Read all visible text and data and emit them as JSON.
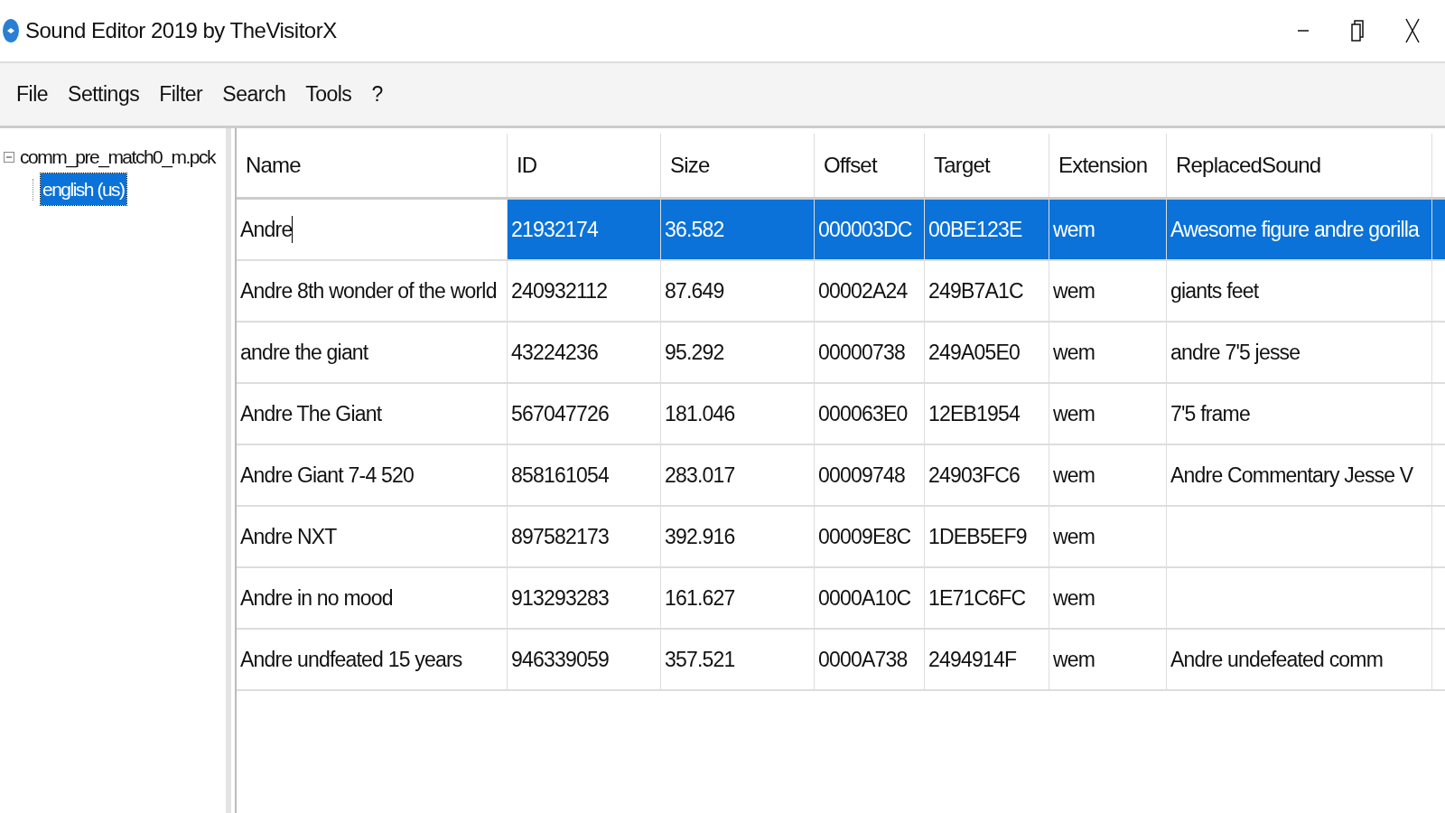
{
  "window": {
    "title": "Sound Editor 2019 by TheVisitorX"
  },
  "menu": [
    "File",
    "Settings",
    "Filter",
    "Search",
    "Tools",
    "?"
  ],
  "tree": [
    {
      "label": "comm_pre_match0_m.pck",
      "expanded": true,
      "selected": false,
      "children": [
        {
          "label": "english (us)",
          "selected": true
        }
      ]
    }
  ],
  "table": {
    "columns": [
      "Name",
      "ID",
      "Size",
      "Offset",
      "Target",
      "Extension",
      "ReplacedSound"
    ],
    "rows": [
      {
        "selected": true,
        "editing": true,
        "cells": [
          "Andre",
          "21932174",
          "36.582",
          "000003DC",
          "00BE123E",
          "wem",
          "Awesome figure andre gorilla"
        ]
      },
      {
        "selected": false,
        "editing": false,
        "cells": [
          "Andre 8th wonder of the world",
          "240932112",
          "87.649",
          "00002A24",
          "249B7A1C",
          "wem",
          "giants feet"
        ]
      },
      {
        "selected": false,
        "editing": false,
        "cells": [
          "andre the giant",
          "43224236",
          "95.292",
          "00000738",
          "249A05E0",
          "wem",
          "andre 7'5 jesse"
        ]
      },
      {
        "selected": false,
        "editing": false,
        "cells": [
          "Andre The Giant",
          "567047726",
          "181.046",
          "000063E0",
          "12EB1954",
          "wem",
          "7'5 frame"
        ]
      },
      {
        "selected": false,
        "editing": false,
        "cells": [
          "Andre Giant 7-4 520",
          "858161054",
          "283.017",
          "00009748",
          "24903FC6",
          "wem",
          "Andre Commentary Jesse V"
        ]
      },
      {
        "selected": false,
        "editing": false,
        "cells": [
          "Andre NXT",
          "897582173",
          "392.916",
          "00009E8C",
          "1DEB5EF9",
          "wem",
          ""
        ]
      },
      {
        "selected": false,
        "editing": false,
        "cells": [
          "Andre in no mood",
          "913293283",
          "161.627",
          "0000A10C",
          "1E71C6FC",
          "wem",
          ""
        ]
      },
      {
        "selected": false,
        "editing": false,
        "cells": [
          "Andre undfeated 15 years",
          "946339059",
          "357.521",
          "0000A738",
          "2494914F",
          "wem",
          "Andre undefeated comm"
        ]
      }
    ]
  }
}
